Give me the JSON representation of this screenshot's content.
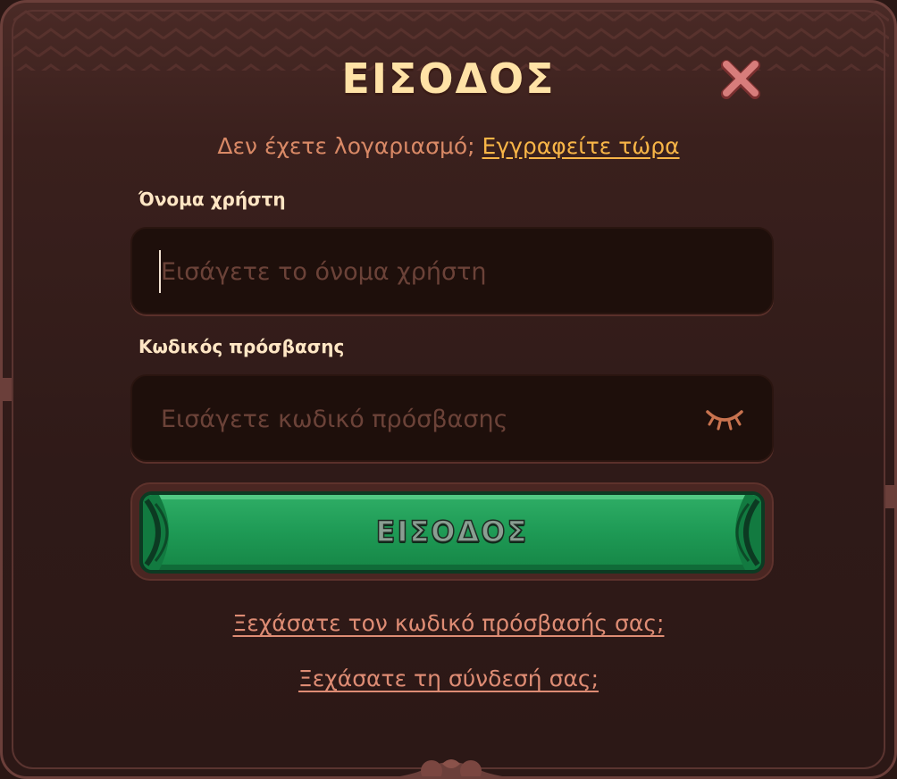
{
  "dialog": {
    "title": "ΕΙΣΟΔΟΣ",
    "close_icon": "close-x-icon",
    "signup_prompt": "Δεν έχετε λογαριασμό;",
    "signup_link": "Εγγραφείτε τώρα",
    "username": {
      "label": "Όνομα χρήστη",
      "placeholder": "Εισάγετε το όνομα χρήστη",
      "value": ""
    },
    "password": {
      "label": "Κωδικός πρόσβασης",
      "placeholder": "Εισάγετε κωδικό πρόσβασης",
      "value": "",
      "toggle_icon": "eye-closed-icon"
    },
    "login_button": "ΕΙΣΟΔΟΣ",
    "forgot_password": "Ξεχάσατε τον κωδικό πρόσβασής σας;",
    "forgot_login": "Ξεχάσατε τη σύνδεσή σας;"
  },
  "colors": {
    "background": "#2f1a18",
    "title": "#ffe2a6",
    "accent_link": "#f8b547",
    "muted_link": "#de8c74",
    "button_green": "#1e9a55",
    "close_icon": "#c96b6b"
  }
}
